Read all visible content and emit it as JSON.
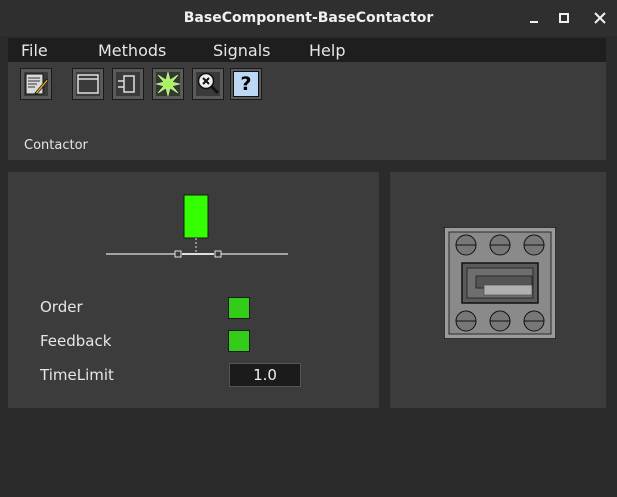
{
  "window": {
    "title": "BaseComponent-BaseContactor",
    "minimize_icon": "minimize-icon",
    "maximize_icon": "maximize-icon",
    "close_icon": "close-icon"
  },
  "menu": {
    "items": [
      "File",
      "Methods",
      "Signals",
      "Help"
    ]
  },
  "toolbar": {
    "buttons": [
      {
        "icon": "graph-notepad-icon"
      },
      {
        "icon": "object-window-icon"
      },
      {
        "icon": "trace-component-icon"
      },
      {
        "icon": "light-burst-icon"
      },
      {
        "icon": "crossreference-search-icon"
      },
      {
        "icon": "help-icon",
        "glyph": "?"
      }
    ],
    "label": "Contactor"
  },
  "contactor": {
    "state_color": "#33ff00",
    "attributes": [
      {
        "label": "Order",
        "type": "indicator",
        "color": "#33cc1a"
      },
      {
        "label": "Feedback",
        "type": "indicator",
        "color": "#33cc1a"
      },
      {
        "label": "TimeLimit",
        "type": "value",
        "value": "1.0"
      }
    ]
  },
  "device_icon": {
    "name": "contactor-device-icon"
  }
}
